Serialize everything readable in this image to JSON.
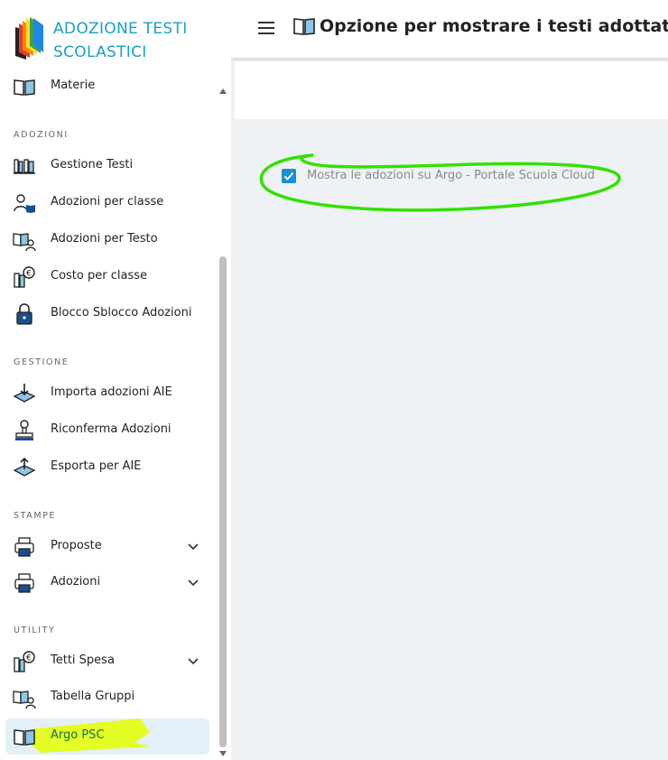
{
  "brand": {
    "title": "ADOZIONE TESTI SCOLASTICI"
  },
  "topbar": {
    "title": "Opzione per mostrare i testi adottati su"
  },
  "sidebar": {
    "partial_item": {
      "label": "Materie",
      "icon": "book-open-icon"
    },
    "sections": [
      {
        "label": "ADOZIONI",
        "items": [
          {
            "label": "Gestione Testi",
            "icon": "bookshelf-icon"
          },
          {
            "label": "Adozioni per classe",
            "icon": "user-book-icon"
          },
          {
            "label": "Adozioni per Testo",
            "icon": "book-user-icon"
          },
          {
            "label": "Costo per classe",
            "icon": "books-euro-icon"
          },
          {
            "label": "Blocco Sblocco Adozioni",
            "icon": "padlock-icon"
          }
        ]
      },
      {
        "label": "GESTIONE",
        "items": [
          {
            "label": "Importa adozioni AIE",
            "icon": "import-tray-icon"
          },
          {
            "label": "Riconferma Adozioni",
            "icon": "stamp-icon"
          },
          {
            "label": "Esporta per AIE",
            "icon": "export-tray-icon"
          }
        ]
      },
      {
        "label": "STAMPE",
        "items": [
          {
            "label": "Proposte",
            "icon": "printer-icon",
            "expandable": true
          },
          {
            "label": "Adozioni",
            "icon": "printer-icon",
            "expandable": true
          }
        ]
      },
      {
        "label": "UTILITY",
        "items": [
          {
            "label": "Tetti Spesa",
            "icon": "books-euro-icon",
            "expandable": true
          },
          {
            "label": "Tabella Gruppi",
            "icon": "book-user-icon"
          },
          {
            "label": "Argo PSC",
            "icon": "book-open-icon",
            "active": true
          }
        ]
      }
    ]
  },
  "content": {
    "option": {
      "label": "Mostra le adozioni su Argo - Portale Scuola Cloud",
      "checked": true
    }
  },
  "colors": {
    "accent": "#1a9ec5",
    "checkbox": "#1a8fd1",
    "active_bg": "#e3f0f7",
    "annotation_green": "#33e000",
    "annotation_yellow": "#e3ff00"
  }
}
